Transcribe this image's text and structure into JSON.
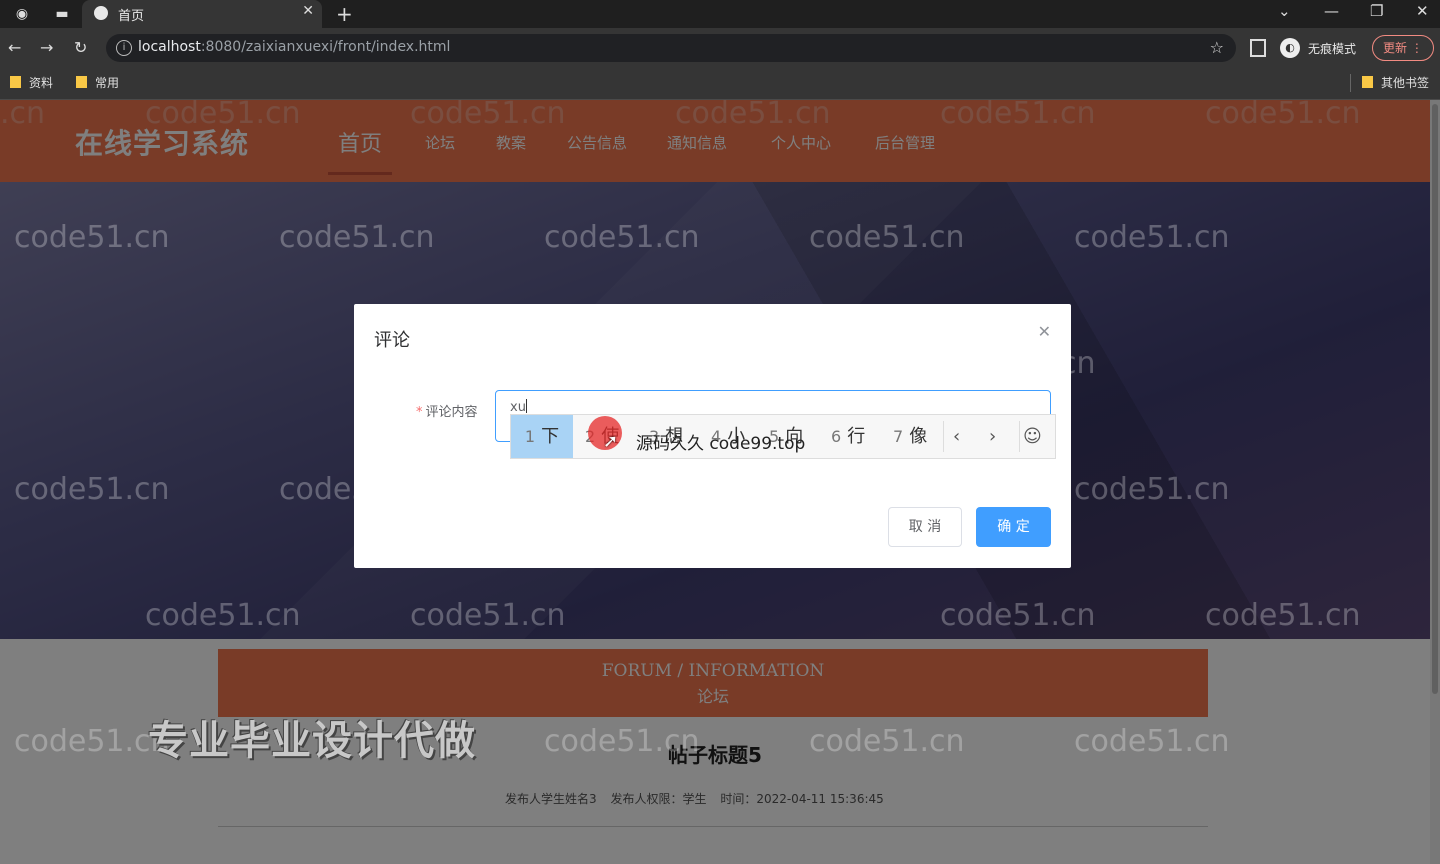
{
  "browser": {
    "tab_title": "首页",
    "url_host": "localhost",
    "url_path": ":8080/zaixianxuexi/front/index.html",
    "incognito_label": "无痕模式",
    "update_label": "更新",
    "bookmarks": [
      "资料",
      "常用"
    ],
    "other_bookmarks": "其他书签"
  },
  "site": {
    "logo": "在线学习系统",
    "nav": [
      "首页",
      "论坛",
      "教案",
      "公告信息",
      "通知信息",
      "个人中心",
      "后台管理"
    ],
    "accent_color": "#f2764f"
  },
  "section": {
    "title_en": "FORUM / INFORMATION",
    "title_cn": "论坛"
  },
  "post": {
    "title": "帖子标题5",
    "meta": [
      "发布人学生姓名3",
      "发布人权限：学生",
      "时间：2022-04-11 15:36:45"
    ]
  },
  "dialog": {
    "title": "评论",
    "field_label": "评论内容",
    "field_value": "xu",
    "cancel_label": "取 消",
    "confirm_label": "确 定",
    "primary_color": "#409eff"
  },
  "ime": {
    "candidates": [
      {
        "n": "1",
        "c": "下"
      },
      {
        "n": "2",
        "c": "使"
      },
      {
        "n": "3",
        "c": "想"
      },
      {
        "n": "4",
        "c": "小"
      },
      {
        "n": "5",
        "c": "向"
      },
      {
        "n": "6",
        "c": "行"
      },
      {
        "n": "7",
        "c": "像"
      }
    ],
    "overlay_text": "源码久久 code99.top"
  },
  "promo_text": "专业毕业设计代做",
  "watermark": "code51.cn"
}
